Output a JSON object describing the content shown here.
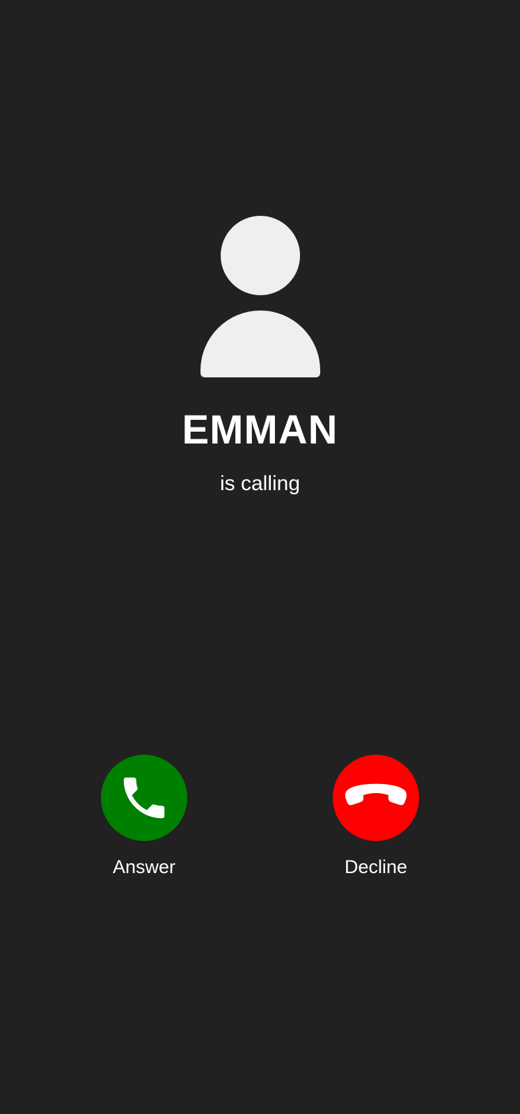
{
  "call": {
    "caller_name": "EMMAN",
    "status": "is calling"
  },
  "avatar": {
    "icon": "person-icon",
    "color": "#efefef"
  },
  "actions": {
    "answer": {
      "label": "Answer",
      "icon": "phone-icon",
      "color": "#008000"
    },
    "decline": {
      "label": "Decline",
      "icon": "phone-hangup-icon",
      "color": "#ff0000"
    }
  },
  "theme": {
    "background": "#212121",
    "text": "#ffffff"
  }
}
